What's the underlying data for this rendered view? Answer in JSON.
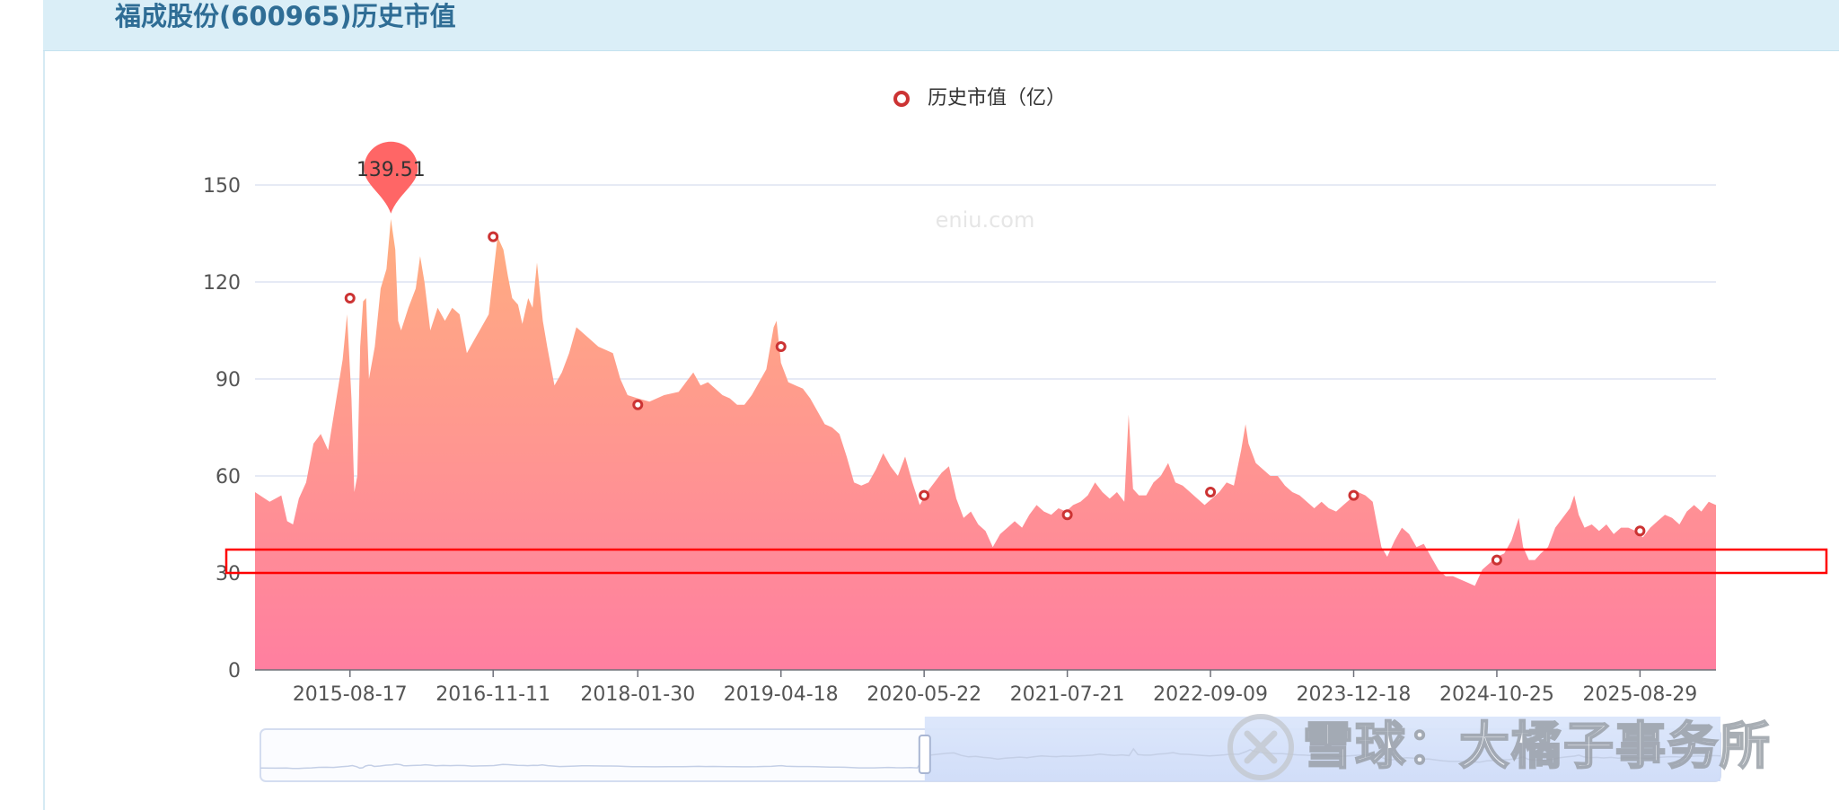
{
  "header": {
    "title": "福成股份(600965)历史市值"
  },
  "legend": {
    "label": "历史市值（亿）",
    "color": "#cc3333"
  },
  "watermarks": {
    "chart": "eniu.com",
    "corner": "雪球：大橘子事务所"
  },
  "highlight_box": {
    "color": "#ff0000"
  },
  "chart_data": {
    "type": "area",
    "title": "",
    "series": [
      {
        "name": "历史市值（亿）"
      }
    ],
    "ylim": [
      0,
      150
    ],
    "yticks": [
      0,
      30,
      60,
      90,
      120,
      150
    ],
    "xticks": [
      "2015-08-17",
      "2016-11-11",
      "2018-01-30",
      "2019-04-18",
      "2020-05-22",
      "2021-07-21",
      "2022-09-09",
      "2023-12-18",
      "2024-10-25",
      "2025-08-29"
    ],
    "grid": true,
    "legend_position": "top-center",
    "max_marker": {
      "label": "139.51",
      "x": 0.093,
      "value": 139.51
    },
    "points": [
      [
        0.0,
        55
      ],
      [
        0.01,
        52
      ],
      [
        0.018,
        54
      ],
      [
        0.022,
        46
      ],
      [
        0.026,
        45
      ],
      [
        0.03,
        53
      ],
      [
        0.035,
        58
      ],
      [
        0.04,
        70
      ],
      [
        0.045,
        73
      ],
      [
        0.05,
        68
      ],
      [
        0.055,
        82
      ],
      [
        0.06,
        96
      ],
      [
        0.063,
        110
      ],
      [
        0.066,
        84
      ],
      [
        0.068,
        55
      ],
      [
        0.07,
        60
      ],
      [
        0.072,
        100
      ],
      [
        0.074,
        114
      ],
      [
        0.076,
        115
      ],
      [
        0.078,
        90
      ],
      [
        0.082,
        100
      ],
      [
        0.086,
        118
      ],
      [
        0.09,
        124
      ],
      [
        0.093,
        139.5
      ],
      [
        0.096,
        130
      ],
      [
        0.098,
        108
      ],
      [
        0.1,
        105
      ],
      [
        0.105,
        112
      ],
      [
        0.11,
        118
      ],
      [
        0.113,
        128
      ],
      [
        0.116,
        120
      ],
      [
        0.12,
        105
      ],
      [
        0.125,
        112
      ],
      [
        0.13,
        108
      ],
      [
        0.135,
        112
      ],
      [
        0.14,
        110
      ],
      [
        0.145,
        98
      ],
      [
        0.15,
        102
      ],
      [
        0.155,
        106
      ],
      [
        0.16,
        110
      ],
      [
        0.163,
        122
      ],
      [
        0.166,
        134
      ],
      [
        0.17,
        130
      ],
      [
        0.173,
        122
      ],
      [
        0.176,
        115
      ],
      [
        0.18,
        113
      ],
      [
        0.183,
        107
      ],
      [
        0.187,
        115
      ],
      [
        0.19,
        112
      ],
      [
        0.193,
        126
      ],
      [
        0.197,
        108
      ],
      [
        0.2,
        100
      ],
      [
        0.205,
        88
      ],
      [
        0.21,
        92
      ],
      [
        0.215,
        98
      ],
      [
        0.22,
        106
      ],
      [
        0.225,
        104
      ],
      [
        0.23,
        102
      ],
      [
        0.235,
        100
      ],
      [
        0.24,
        99
      ],
      [
        0.245,
        98
      ],
      [
        0.25,
        90
      ],
      [
        0.255,
        85
      ],
      [
        0.262,
        84
      ],
      [
        0.27,
        83
      ],
      [
        0.28,
        85
      ],
      [
        0.29,
        86
      ],
      [
        0.3,
        92
      ],
      [
        0.305,
        88
      ],
      [
        0.31,
        89
      ],
      [
        0.315,
        87
      ],
      [
        0.32,
        85
      ],
      [
        0.325,
        84
      ],
      [
        0.33,
        82
      ],
      [
        0.335,
        82
      ],
      [
        0.34,
        85
      ],
      [
        0.345,
        89
      ],
      [
        0.35,
        93
      ],
      [
        0.355,
        106
      ],
      [
        0.357,
        108
      ],
      [
        0.36,
        95
      ],
      [
        0.365,
        89
      ],
      [
        0.37,
        88
      ],
      [
        0.375,
        87
      ],
      [
        0.38,
        84
      ],
      [
        0.385,
        80
      ],
      [
        0.39,
        76
      ],
      [
        0.395,
        75
      ],
      [
        0.4,
        73
      ],
      [
        0.405,
        66
      ],
      [
        0.41,
        58
      ],
      [
        0.415,
        57
      ],
      [
        0.42,
        58
      ],
      [
        0.425,
        62
      ],
      [
        0.43,
        67
      ],
      [
        0.435,
        63
      ],
      [
        0.44,
        60
      ],
      [
        0.445,
        66
      ],
      [
        0.45,
        58
      ],
      [
        0.455,
        51
      ],
      [
        0.46,
        55
      ],
      [
        0.465,
        58
      ],
      [
        0.47,
        61
      ],
      [
        0.475,
        63
      ],
      [
        0.48,
        53
      ],
      [
        0.485,
        47
      ],
      [
        0.49,
        49
      ],
      [
        0.495,
        45
      ],
      [
        0.5,
        43
      ],
      [
        0.505,
        38
      ],
      [
        0.51,
        42
      ],
      [
        0.515,
        44
      ],
      [
        0.52,
        46
      ],
      [
        0.525,
        44
      ],
      [
        0.53,
        48
      ],
      [
        0.535,
        51
      ],
      [
        0.54,
        49
      ],
      [
        0.545,
        48
      ],
      [
        0.55,
        50
      ],
      [
        0.555,
        49
      ],
      [
        0.56,
        51
      ],
      [
        0.565,
        52
      ],
      [
        0.57,
        54
      ],
      [
        0.575,
        58
      ],
      [
        0.58,
        55
      ],
      [
        0.585,
        53
      ],
      [
        0.59,
        55
      ],
      [
        0.595,
        52
      ],
      [
        0.598,
        79
      ],
      [
        0.601,
        56
      ],
      [
        0.605,
        54
      ],
      [
        0.61,
        54
      ],
      [
        0.615,
        58
      ],
      [
        0.62,
        60
      ],
      [
        0.625,
        64
      ],
      [
        0.63,
        58
      ],
      [
        0.635,
        57
      ],
      [
        0.64,
        55
      ],
      [
        0.645,
        53
      ],
      [
        0.65,
        51
      ],
      [
        0.655,
        53
      ],
      [
        0.66,
        55
      ],
      [
        0.665,
        58
      ],
      [
        0.67,
        57
      ],
      [
        0.675,
        68
      ],
      [
        0.678,
        76
      ],
      [
        0.68,
        70
      ],
      [
        0.685,
        64
      ],
      [
        0.69,
        62
      ],
      [
        0.695,
        60
      ],
      [
        0.7,
        60
      ],
      [
        0.705,
        57
      ],
      [
        0.71,
        55
      ],
      [
        0.715,
        54
      ],
      [
        0.72,
        52
      ],
      [
        0.725,
        50
      ],
      [
        0.73,
        52
      ],
      [
        0.735,
        50
      ],
      [
        0.74,
        49
      ],
      [
        0.745,
        51
      ],
      [
        0.75,
        53
      ],
      [
        0.755,
        55
      ],
      [
        0.76,
        54
      ],
      [
        0.765,
        52
      ],
      [
        0.768,
        45
      ],
      [
        0.771,
        38
      ],
      [
        0.775,
        35
      ],
      [
        0.78,
        40
      ],
      [
        0.785,
        44
      ],
      [
        0.79,
        42
      ],
      [
        0.795,
        38
      ],
      [
        0.8,
        39
      ],
      [
        0.805,
        35
      ],
      [
        0.81,
        31
      ],
      [
        0.815,
        29
      ],
      [
        0.82,
        29
      ],
      [
        0.825,
        28
      ],
      [
        0.83,
        27
      ],
      [
        0.835,
        26
      ],
      [
        0.84,
        31
      ],
      [
        0.845,
        33
      ],
      [
        0.85,
        35
      ],
      [
        0.855,
        36
      ],
      [
        0.86,
        40
      ],
      [
        0.865,
        47
      ],
      [
        0.868,
        38
      ],
      [
        0.872,
        34
      ],
      [
        0.876,
        34
      ],
      [
        0.88,
        36
      ],
      [
        0.885,
        38
      ],
      [
        0.89,
        44
      ],
      [
        0.895,
        47
      ],
      [
        0.9,
        50
      ],
      [
        0.903,
        54
      ],
      [
        0.906,
        48
      ],
      [
        0.91,
        44
      ],
      [
        0.915,
        45
      ],
      [
        0.92,
        43
      ],
      [
        0.925,
        45
      ],
      [
        0.93,
        42
      ],
      [
        0.935,
        44
      ],
      [
        0.94,
        44
      ],
      [
        0.945,
        43
      ],
      [
        0.95,
        41
      ],
      [
        0.955,
        44
      ],
      [
        0.96,
        46
      ],
      [
        0.965,
        48
      ],
      [
        0.97,
        47
      ],
      [
        0.975,
        45
      ],
      [
        0.98,
        49
      ],
      [
        0.985,
        51
      ],
      [
        0.99,
        49
      ],
      [
        0.995,
        52
      ],
      [
        1.0,
        51
      ]
    ],
    "sample_markers": [
      {
        "x": 0.065,
        "value": 115
      },
      {
        "x": 0.163,
        "value": 134
      },
      {
        "x": 0.262,
        "value": 82
      },
      {
        "x": 0.36,
        "value": 100
      },
      {
        "x": 0.458,
        "value": 54
      },
      {
        "x": 0.556,
        "value": 48
      },
      {
        "x": 0.654,
        "value": 55
      },
      {
        "x": 0.752,
        "value": 54
      },
      {
        "x": 0.85,
        "value": 34
      },
      {
        "x": 0.948,
        "value": 43
      }
    ],
    "colors": {
      "area_top": "#ffae80",
      "area_bottom": "#ff7fa0",
      "marker": "#cc3333",
      "max_marker": "#ff6666",
      "grid": "#dde3f2",
      "axis_text": "#555555"
    },
    "data_zoom": {
      "start_fraction": 0.455,
      "end_fraction": 1.0
    }
  }
}
